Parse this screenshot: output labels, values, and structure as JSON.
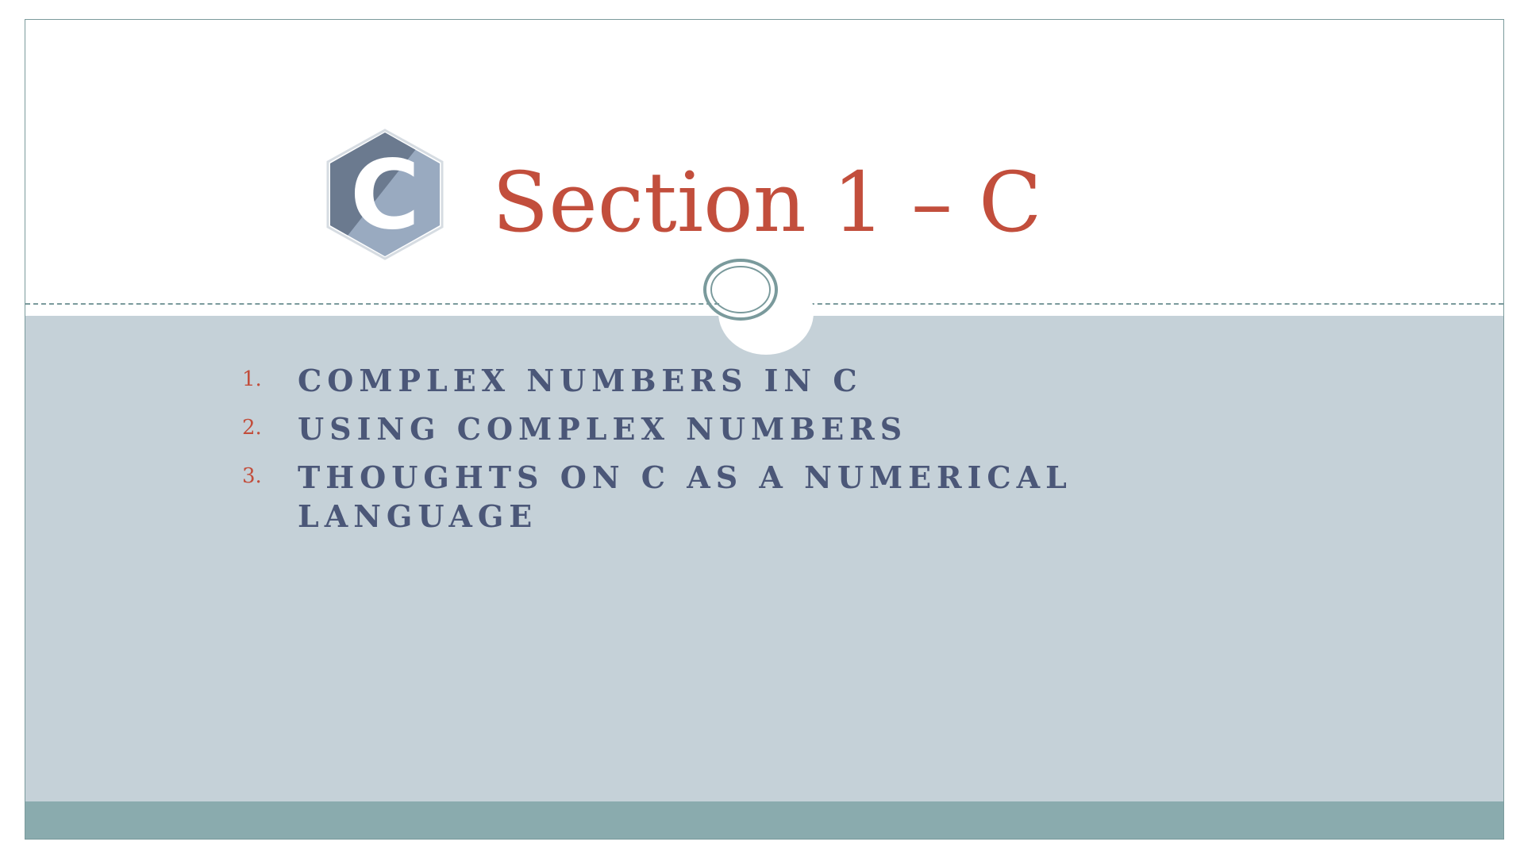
{
  "slide": {
    "title": "Section 1 – C",
    "logo": {
      "icon": "c-language-hexagon-logo",
      "letter": "C",
      "colors": {
        "dark": "#6b7a8f",
        "light": "#99aac0",
        "letter": "#ffffff"
      }
    },
    "agenda": [
      {
        "number": "1.",
        "text": "COMPLEX NUMBERS IN C"
      },
      {
        "number": "2.",
        "text": "USING COMPLEX NUMBERS"
      },
      {
        "number": "3.",
        "text": "THOUGHTS ON C AS A NUMERICAL LANGUAGE"
      }
    ]
  },
  "theme": {
    "title_color": "#c24e3c",
    "number_color": "#c24e3c",
    "text_color": "#4b5778",
    "body_background": "#c5d1d8",
    "footer_color": "#8aabae",
    "divider_color": "#7a9a9c"
  }
}
